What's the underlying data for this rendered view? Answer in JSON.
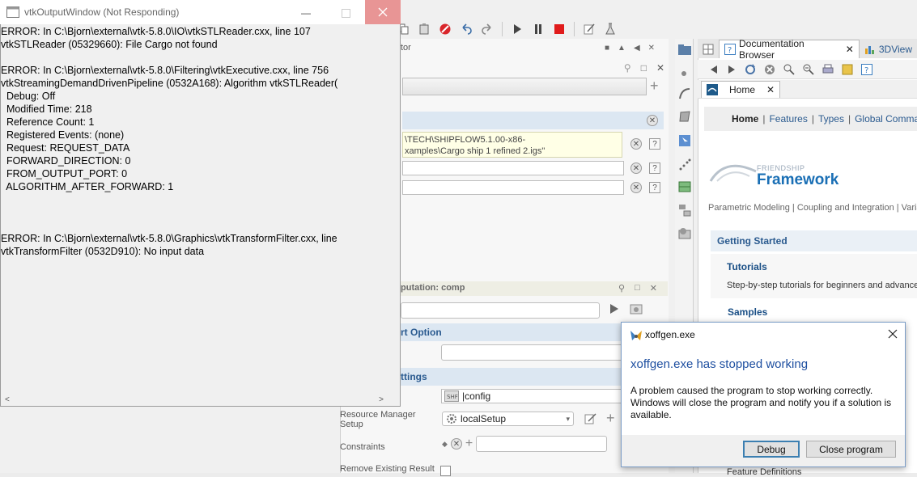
{
  "vtk_window": {
    "title": "vtkOutputWindow (Not Responding)",
    "lines": [
      "ERROR: In C:\\Bjorn\\external\\vtk-5.8.0\\IO\\vtkSTLReader.cxx, line 107",
      "vtkSTLReader (05329660): File Cargo not found",
      "",
      "ERROR: In C:\\Bjorn\\external\\vtk-5.8.0\\Filtering\\vtkExecutive.cxx, line 756",
      "vtkStreamingDemandDrivenPipeline (0532A168): Algorithm vtkSTLReader(",
      "  Debug: Off",
      "  Modified Time: 218",
      "  Reference Count: 1",
      "  Registered Events: (none)",
      "  Request: REQUEST_DATA",
      "  FORWARD_DIRECTION: 0",
      "  FROM_OUTPUT_PORT: 0",
      "  ALGORITHM_AFTER_FORWARD: 1",
      "",
      "",
      "",
      "ERROR: In C:\\Bjorn\\external\\vtk-5.8.0\\Graphics\\vtkTransformFilter.cxx, line",
      "vtkTransformFilter (0532D910): No input data"
    ]
  },
  "error_dialog": {
    "title": "xoffgen.exe",
    "heading": "xoffgen.exe has stopped working",
    "message": "A problem caused the program to stop working correctly. Windows will close the program and notify you if a solution is available.",
    "debug_label": "Debug",
    "close_label": "Close program"
  },
  "editor": {
    "title_fragment": "tor",
    "file_path_line1": "\\TECH\\SHIPFLOW5.1.00-x86-",
    "file_path_line2": "xamples\\Cargo ship 1 refined 2.igs\""
  },
  "computation": {
    "title_fragment": "putation: comp",
    "start_option": "rt Option",
    "settings": "ttings",
    "config_value": "|config",
    "resource_manager_label": "Resource Manager Setup",
    "resource_manager_value": "localSetup",
    "constraints_label": "Constraints",
    "remove_label": "Remove Existing Result"
  },
  "doc": {
    "tab_label": "Documentation Browser",
    "tab2_label": "3DView",
    "home_tab": "Home",
    "menu": {
      "home": "Home",
      "features": "Features",
      "types": "Types",
      "global_commands": "Global Commands"
    },
    "brand_small": "FRIENDSHIP",
    "brand_big": "Framework",
    "tagline": "Parametric Modeling | Coupling and Integration | Varia",
    "getting_started": "Getting Started",
    "tutorials": "Tutorials",
    "tutorials_desc": "Step-by-step tutorials for beginners and advance",
    "samples": "Samples",
    "feature_defs": "Feature Definitions"
  }
}
